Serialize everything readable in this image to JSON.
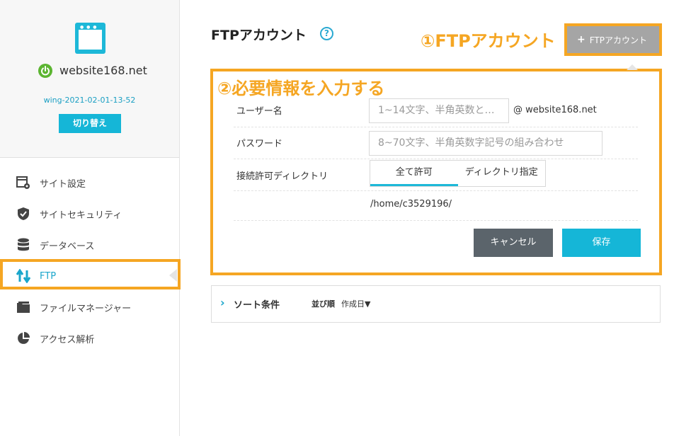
{
  "sidebar": {
    "site_name": "website168.net",
    "server_id": "wing-2021-02-01-13-52",
    "switch_label": "切り替え",
    "items": [
      {
        "label": "サイト設定",
        "icon": "site-settings-icon"
      },
      {
        "label": "サイトセキュリティ",
        "icon": "shield-check-icon"
      },
      {
        "label": "データベース",
        "icon": "database-icon"
      },
      {
        "label": "FTP",
        "icon": "transfer-arrows-icon"
      },
      {
        "label": "ファイルマネージャー",
        "icon": "folder-icon"
      },
      {
        "label": "アクセス解析",
        "icon": "pie-chart-icon"
      }
    ]
  },
  "header": {
    "title": "FTPアカウント",
    "add_button_label": "FTPアカウント",
    "annotation_1": "①FTPアカウント"
  },
  "form": {
    "annotation_2": "②必要情報を入力する",
    "username_label": "ユーザー名",
    "username_placeholder": "1~14文字、半角英数と…",
    "domain_suffix": "@ website168.net",
    "password_label": "パスワード",
    "password_placeholder": "8~70文字、半角英数字記号の組み合わせ",
    "directory_label": "接続許可ディレクトリ",
    "directory_options": [
      "全て許可",
      "ディレクトリ指定"
    ],
    "directory_selected": "全て許可",
    "directory_path": "/home/c3529196/",
    "cancel_label": "キャンセル",
    "save_label": "保存"
  },
  "sort": {
    "title": "ソート条件",
    "order_label": "並び順",
    "order_value": "作成日▼"
  },
  "colors": {
    "accent": "#15b6d7",
    "highlight": "#f5a623",
    "cancel": "#5b646b",
    "status_on": "#5cb531"
  }
}
